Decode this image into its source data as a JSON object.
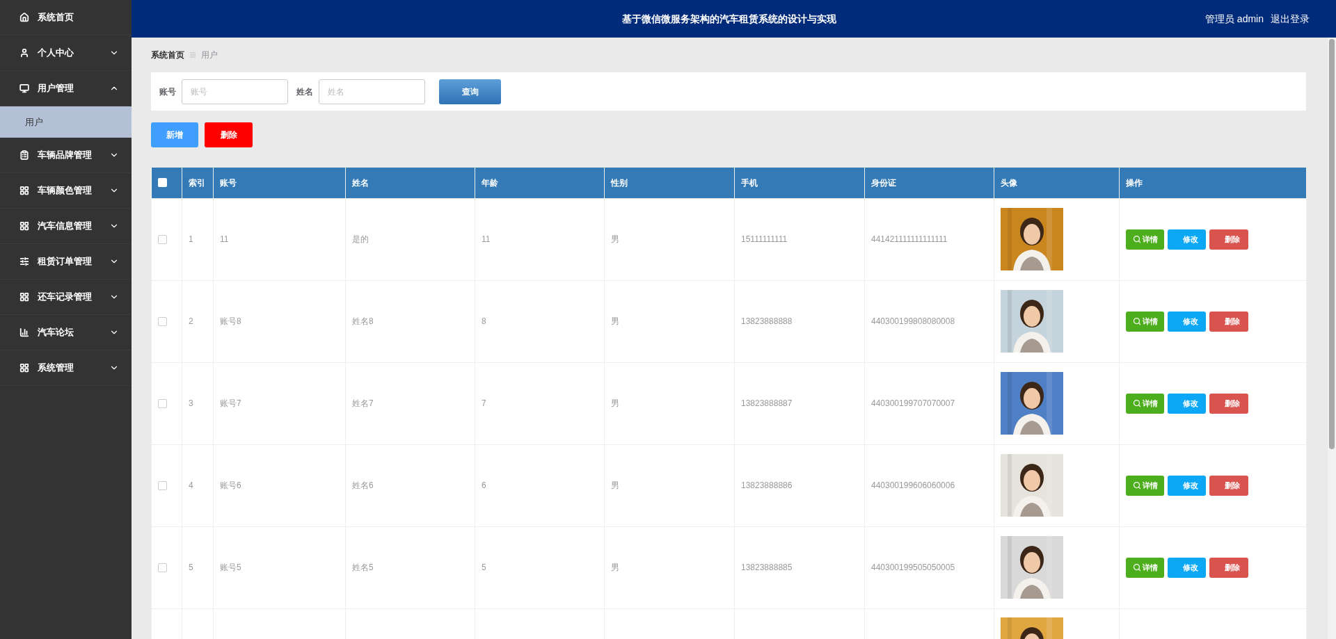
{
  "header": {
    "title": "基于微信微服务架构的汽车租赁系统的设计与实现",
    "user": "管理员 admin",
    "logout": "退出登录"
  },
  "sidebar": {
    "items": [
      {
        "label": "系统首页",
        "kind": "link"
      },
      {
        "label": "个人中心",
        "kind": "menu",
        "expanded": false
      },
      {
        "label": "用户管理",
        "kind": "menu",
        "expanded": true,
        "children": [
          {
            "label": "用户",
            "selected": true
          }
        ]
      },
      {
        "label": "车辆品牌管理",
        "kind": "menu",
        "expanded": false
      },
      {
        "label": "车辆颜色管理",
        "kind": "menu",
        "expanded": false
      },
      {
        "label": "汽车信息管理",
        "kind": "menu",
        "expanded": false
      },
      {
        "label": "租赁订单管理",
        "kind": "menu",
        "expanded": false
      },
      {
        "label": "还车记录管理",
        "kind": "menu",
        "expanded": false
      },
      {
        "label": "汽车论坛",
        "kind": "menu",
        "expanded": false
      },
      {
        "label": "系统管理",
        "kind": "menu",
        "expanded": false
      }
    ]
  },
  "breadcrumb": [
    "系统首页",
    "用户"
  ],
  "search": {
    "fields": [
      {
        "label": "账号",
        "placeholder": "账号"
      },
      {
        "label": "姓名",
        "placeholder": "姓名"
      }
    ],
    "button": "查询"
  },
  "actions": [
    "新增",
    "删除"
  ],
  "table": {
    "select_all_checked": false,
    "columns": [
      "索引",
      "账号",
      "姓名",
      "年龄",
      "性别",
      "手机",
      "身份证",
      "头像",
      "操作"
    ],
    "rows": [
      {
        "checked": false,
        "cells": [
          "1",
          "11",
          "是的",
          "11",
          "男",
          "15111111111",
          "441421111111111111"
        ],
        "avatar": {
          "kind": "picture"
        },
        "actions": [
          "详情",
          "修改",
          "删除"
        ]
      },
      {
        "checked": false,
        "cells": [
          "2",
          "账号8",
          "姓名8",
          "8",
          "男",
          "13823888888",
          "440300199808080008"
        ],
        "avatar": {
          "kind": "picture"
        },
        "actions": [
          "详情",
          "修改",
          "删除"
        ]
      },
      {
        "checked": false,
        "cells": [
          "3",
          "账号7",
          "姓名7",
          "7",
          "男",
          "13823888887",
          "440300199707070007"
        ],
        "avatar": {
          "kind": "picture"
        },
        "actions": [
          "详情",
          "修改",
          "删除"
        ]
      },
      {
        "checked": false,
        "cells": [
          "4",
          "账号6",
          "姓名6",
          "6",
          "男",
          "13823888886",
          "440300199606060006"
        ],
        "avatar": {
          "kind": "picture"
        },
        "actions": [
          "详情",
          "修改",
          "删除"
        ]
      },
      {
        "checked": false,
        "cells": [
          "5",
          "账号5",
          "姓名5",
          "5",
          "男",
          "13823888885",
          "440300199505050005"
        ],
        "avatar": {
          "kind": "picture"
        },
        "actions": [
          "详情",
          "修改",
          "删除"
        ]
      },
      {
        "avatar": {
          "kind": "picture"
        }
      }
    ]
  }
}
